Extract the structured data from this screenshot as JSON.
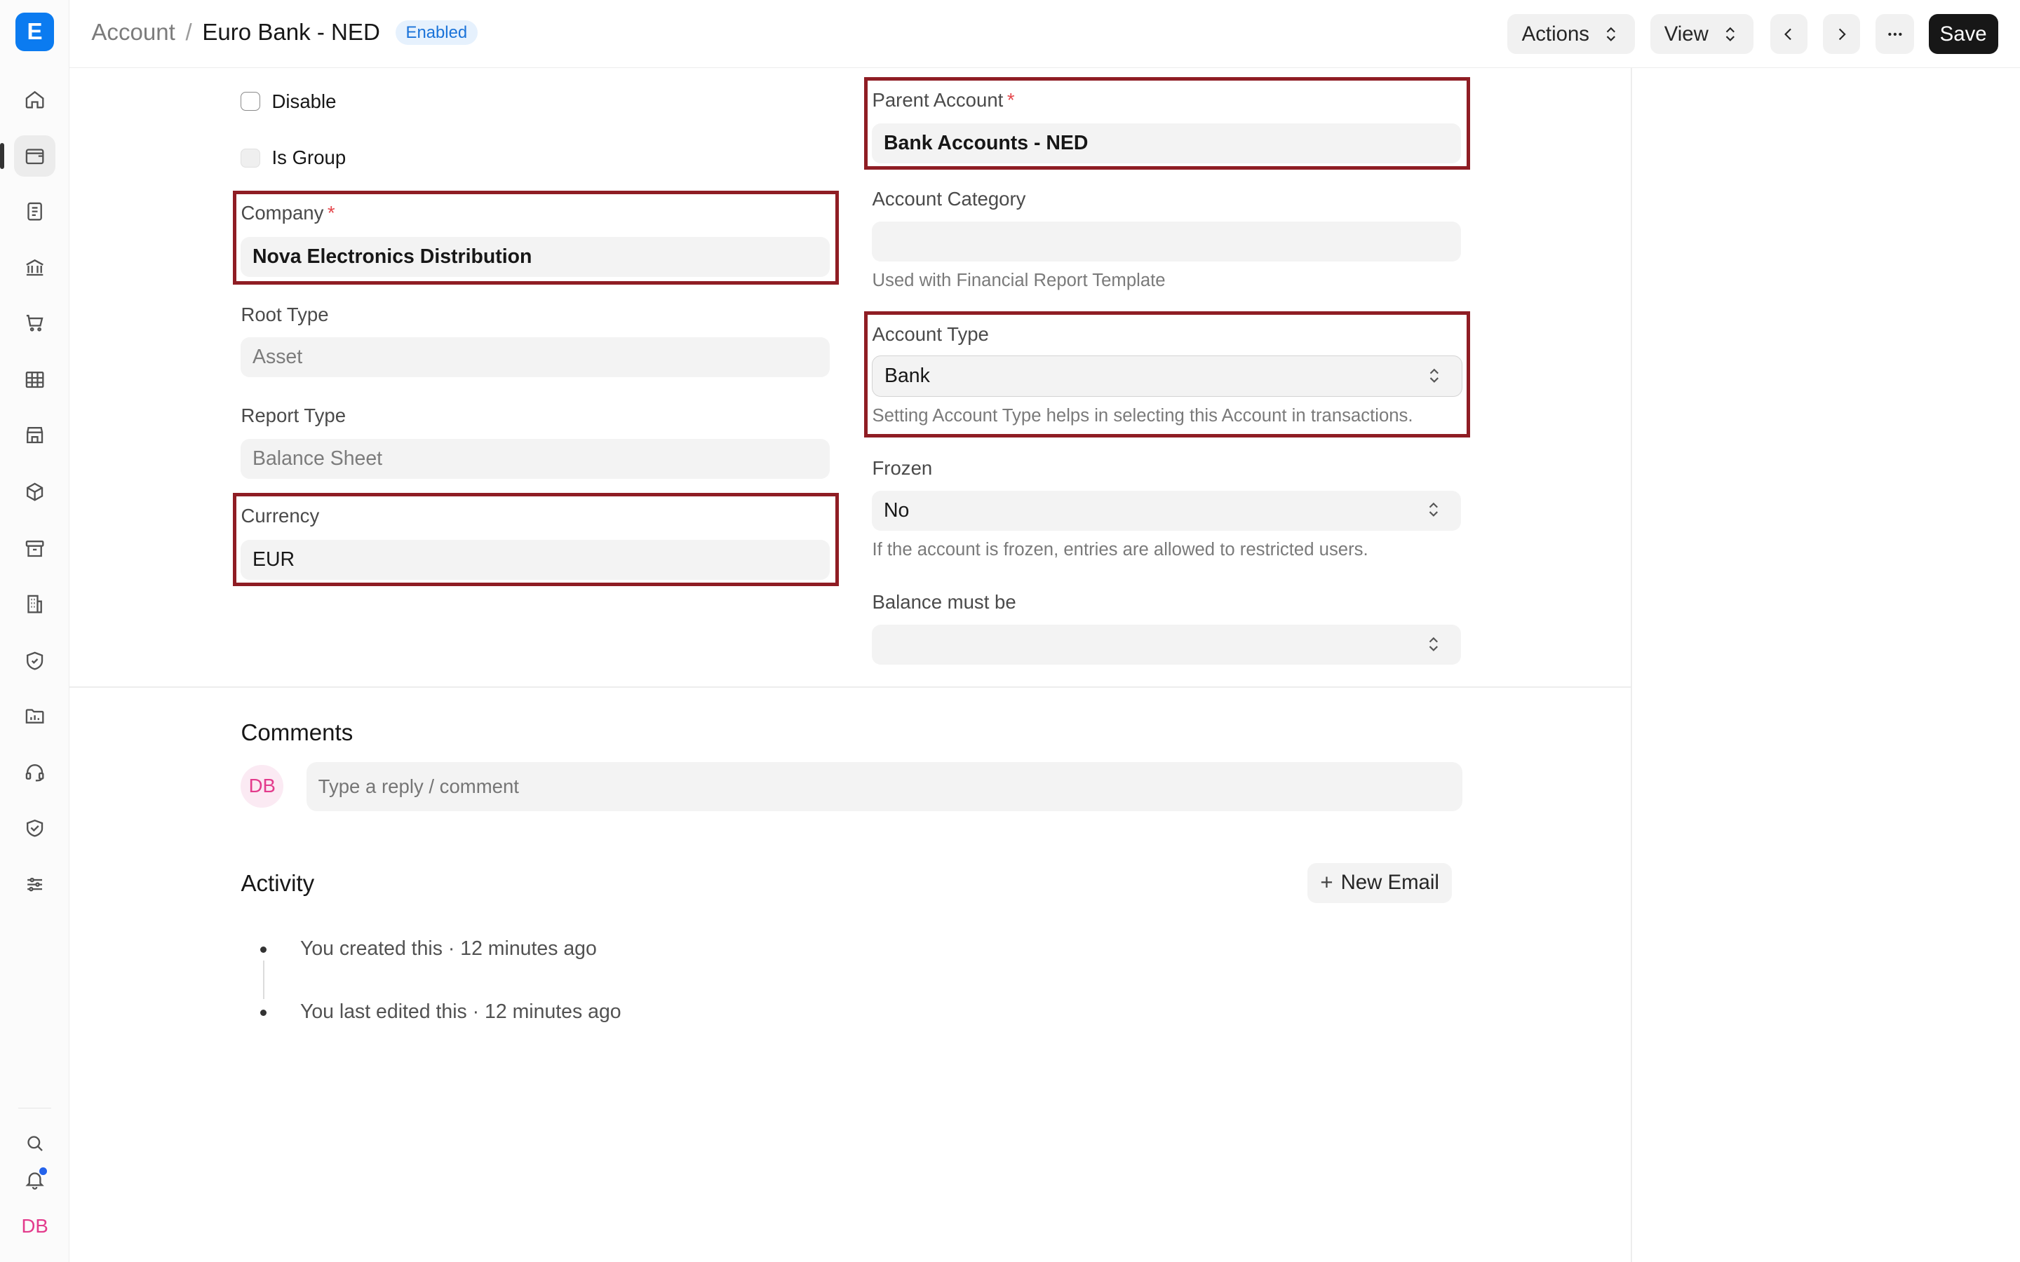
{
  "app": {
    "logo_letter": "E"
  },
  "breadcrumb": {
    "root": "Account",
    "separator": "/",
    "current": "Euro Bank - NED",
    "status": "Enabled"
  },
  "header": {
    "actions_label": "Actions",
    "view_label": "View",
    "save_label": "Save"
  },
  "sidebar": {
    "items": [
      {
        "icon": "home-icon"
      },
      {
        "icon": "wallet-icon"
      },
      {
        "icon": "document-icon"
      },
      {
        "icon": "bank-icon"
      },
      {
        "icon": "cart-icon"
      },
      {
        "icon": "table-icon"
      },
      {
        "icon": "store-icon"
      },
      {
        "icon": "package-icon"
      },
      {
        "icon": "archive-icon"
      },
      {
        "icon": "building-icon"
      },
      {
        "icon": "shield-icon"
      },
      {
        "icon": "folder-chart-icon"
      },
      {
        "icon": "headset-icon"
      },
      {
        "icon": "handshake-icon"
      },
      {
        "icon": "sliders-icon"
      }
    ],
    "user_initials": "DB"
  },
  "form": {
    "disable_label": "Disable",
    "is_group_label": "Is Group",
    "company": {
      "label": "Company",
      "value": "Nova Electronics Distribution"
    },
    "root_type": {
      "label": "Root Type",
      "value": "Asset"
    },
    "report_type": {
      "label": "Report Type",
      "value": "Balance Sheet"
    },
    "currency": {
      "label": "Currency",
      "value": "EUR"
    },
    "parent_account": {
      "label": "Parent Account",
      "value": "Bank Accounts - NED"
    },
    "account_category": {
      "label": "Account Category",
      "value": "",
      "description": "Used with Financial Report Template"
    },
    "account_type": {
      "label": "Account Type",
      "value": "Bank",
      "description": "Setting Account Type helps in selecting this Account in transactions."
    },
    "frozen": {
      "label": "Frozen",
      "value": "No",
      "description": "If the account is frozen, entries are allowed to restricted users."
    },
    "balance_must_be": {
      "label": "Balance must be",
      "value": ""
    },
    "required_mark": "*"
  },
  "comments": {
    "title": "Comments",
    "avatar_initials": "DB",
    "placeholder": "Type a reply / comment"
  },
  "activity": {
    "title": "Activity",
    "new_email_label": "New Email",
    "items": [
      "You created this · 12 minutes ago",
      "You last edited this · 12 minutes ago"
    ]
  },
  "colors": {
    "accent": "#0b7bf0",
    "highlight": "#8f1d24",
    "status_badge": "#1a73d9"
  }
}
